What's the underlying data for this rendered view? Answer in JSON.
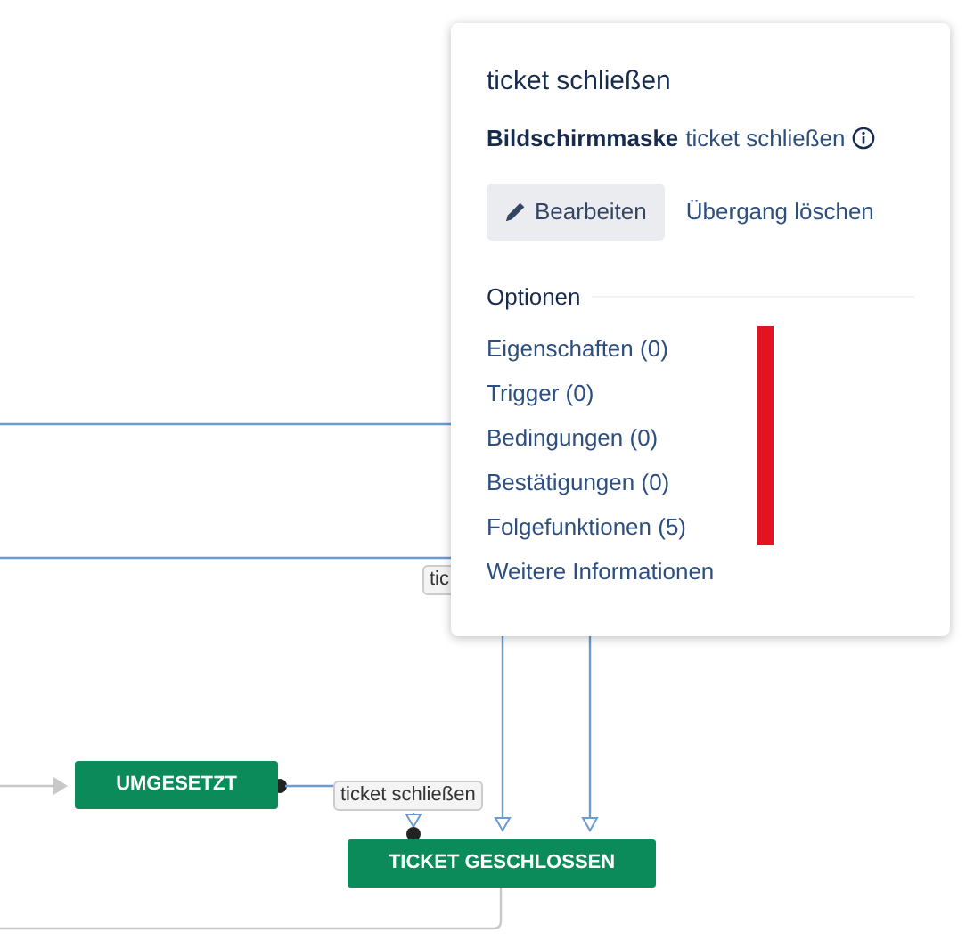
{
  "diagram": {
    "nodes": [
      {
        "label": "UMGESETZT"
      },
      {
        "label": "TICKET GESCHLOSSEN"
      }
    ],
    "edge_labels": [
      {
        "text": "tic"
      },
      {
        "text": "ticket schließen"
      }
    ]
  },
  "popover": {
    "title": "ticket schließen",
    "screen_label": "Bildschirmmaske",
    "screen_link": "ticket schließen",
    "actions": [
      {
        "kind": "button",
        "label": "Bearbeiten"
      },
      {
        "kind": "link",
        "label": "Übergang löschen"
      }
    ],
    "section_title": "Optionen",
    "options": [
      "Eigenschaften (0)",
      "Trigger (0)",
      "Bedingungen (0)",
      "Bestätigungen (0)",
      "Folgefunktionen (5)",
      "Weitere Informationen"
    ]
  }
}
